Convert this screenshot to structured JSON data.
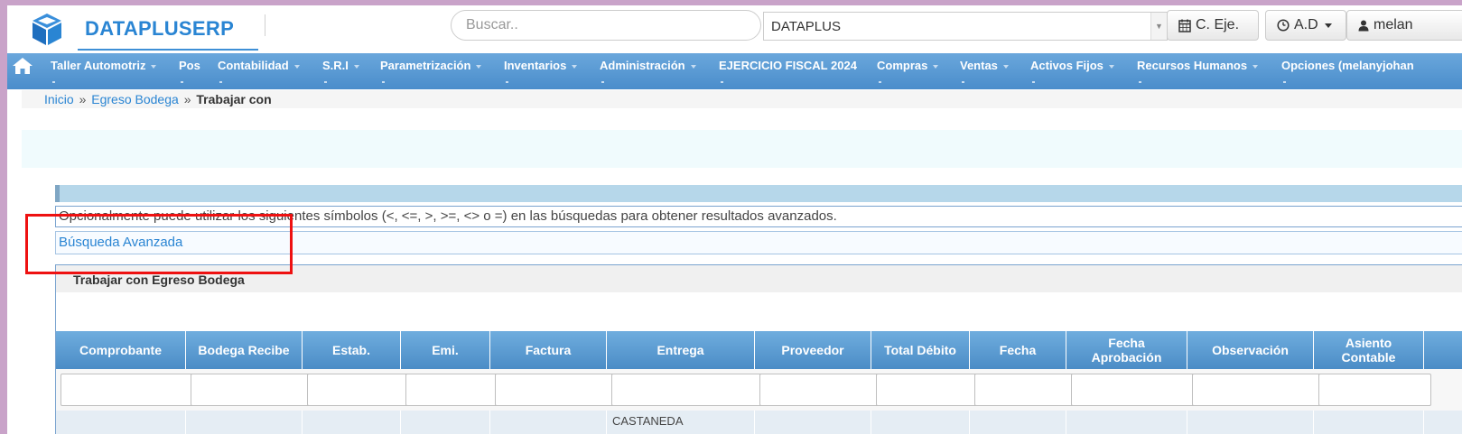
{
  "header": {
    "brand": "DATAPLUSERP",
    "search_placeholder": "Buscar..",
    "company_select": "DATAPLUS",
    "btn_ejercicio": "C. Eje.",
    "btn_ad": "A.D",
    "btn_user": "melan"
  },
  "nav": {
    "items": [
      {
        "label": "Taller Automotriz"
      },
      {
        "label": "Pos"
      },
      {
        "label": "Contabilidad"
      },
      {
        "label": "S.R.I"
      },
      {
        "label": "Parametrización"
      },
      {
        "label": "Inventarios"
      },
      {
        "label": "Administración"
      },
      {
        "label": "EJERCICIO FISCAL 2024"
      },
      {
        "label": "Compras"
      },
      {
        "label": "Ventas"
      },
      {
        "label": "Activos Fijos"
      },
      {
        "label": "Recursos Humanos"
      },
      {
        "label": "Opciones (melanyjohan"
      }
    ]
  },
  "breadcrumb": {
    "home": "Inicio",
    "sep": "»",
    "section": "Egreso Bodega",
    "current": "Trabajar con"
  },
  "info_text": "Opcionalmente puede utilizar los siguientes símbolos (<, <=, >, >=, <> o =) en las búsquedas para obtener resultados avanzados.",
  "advanced_search": "Búsqueda Avanzada",
  "panel": {
    "title": "Trabajar con Egreso Bodega",
    "columns": [
      "Comprobante",
      "Bodega Recibe",
      "Estab.",
      "Emi.",
      "Factura",
      "Entrega",
      "Proveedor",
      "Total Débito",
      "Fecha",
      "Fecha Aprobación",
      "Observación",
      "Asiento Contable"
    ],
    "first_row": {
      "entrega": "CASTANEDA"
    }
  },
  "colors": {
    "brand": "#2a85d3",
    "navbar": "#4a8dcb",
    "grid_header": "#4b8cc6",
    "highlight": "#ee1111"
  }
}
